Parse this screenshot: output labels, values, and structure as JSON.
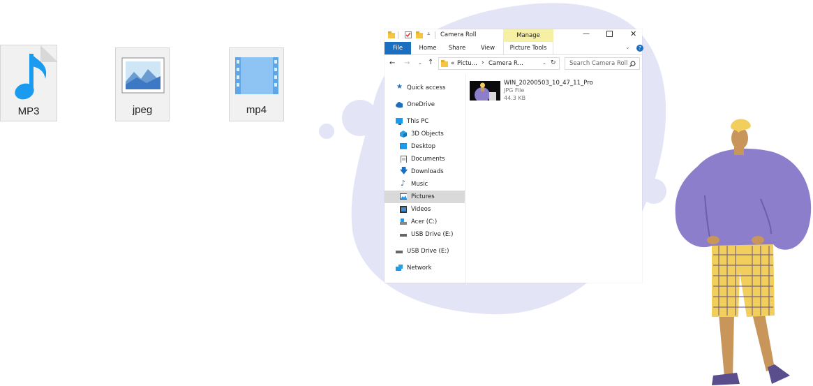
{
  "file_icons": [
    {
      "label": "MP3",
      "icon": "music-note-icon"
    },
    {
      "label": "jpeg",
      "icon": "image-icon"
    },
    {
      "label": "mp4",
      "icon": "film-icon"
    }
  ],
  "explorer": {
    "title": "Camera Roll",
    "manage_tab": "Manage",
    "ribbon_tabs": [
      "File",
      "Home",
      "Share",
      "View",
      "Picture Tools"
    ],
    "breadcrumb": {
      "overflow": "«",
      "segments": [
        "Pictu...",
        "Camera R..."
      ]
    },
    "search_placeholder": "Search Camera Roll",
    "nav": {
      "quick_access": "Quick access",
      "onedrive": "OneDrive",
      "this_pc": "This PC",
      "this_pc_children": [
        "3D Objects",
        "Desktop",
        "Documents",
        "Downloads",
        "Music",
        "Pictures",
        "Videos",
        "Acer (C:)",
        "USB Drive (E:)"
      ],
      "usb_drive": "USB Drive (E:)",
      "network": "Network",
      "selected": "Pictures"
    },
    "file": {
      "name": "WIN_20200503_10_47_11_Pro",
      "type": "JPG File",
      "size": "44.3 KB"
    }
  },
  "colors": {
    "accent_blue": "#1b6fc0",
    "manage_yellow": "#f6f0a4",
    "blob_lavender": "#e3e4f6",
    "person_purple": "#8d7ecb",
    "pants_yellow": "#f2cf5c",
    "skin": "#c8955a"
  }
}
